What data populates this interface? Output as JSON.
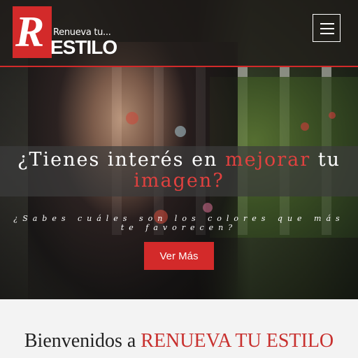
{
  "brand": {
    "logo_letter": "R",
    "tagline": "Renueva tu...",
    "wordmark": "ESTILO",
    "accent_color": "#d32a2a"
  },
  "nav": {
    "menu_icon": "hamburger-icon"
  },
  "hero": {
    "headline_part1": "¿Tienes interés en ",
    "headline_accent1": "mejorar",
    "headline_part2": " tu ",
    "headline_accent2": "imagen?",
    "subtext_line1": "¿Sabes cuáles son los colores que más",
    "subtext_line2": "te favorecen?",
    "cta_label": "Ver Más"
  },
  "welcome": {
    "title_prefix": "Bienvenidos a ",
    "title_brand": "RENUEVA TU ESTILO"
  }
}
